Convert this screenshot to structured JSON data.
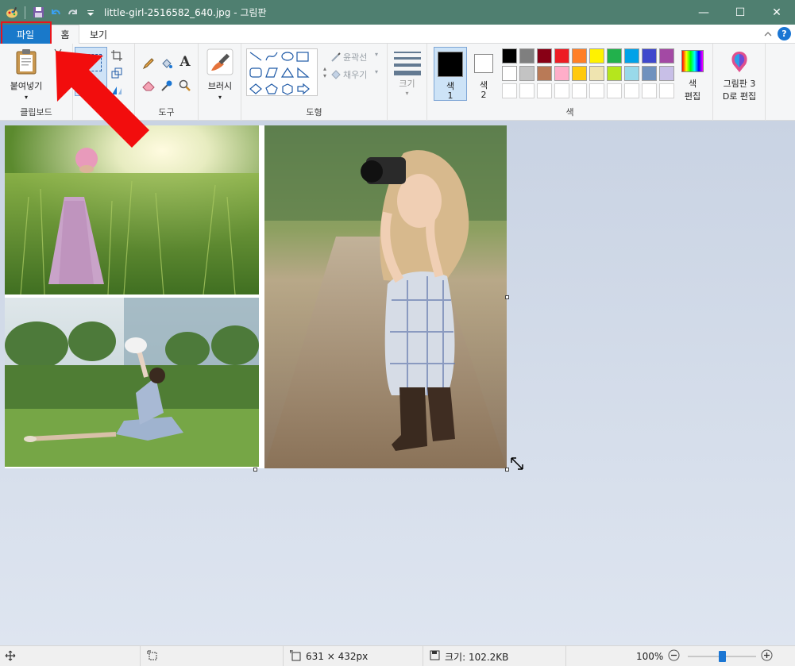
{
  "window": {
    "title": "little-girl-2516582_640.jpg - 그림판",
    "controls": {
      "minimize": "—",
      "maximize": "☐",
      "close": "✕"
    }
  },
  "menu": {
    "file": "파일",
    "home": "홈",
    "view": "보기"
  },
  "ribbon": {
    "clipboard": {
      "paste": "붙여넣기",
      "label": "클립보드"
    },
    "tools": {
      "label": "도구"
    },
    "brushes": {
      "label": "브러시"
    },
    "shapes": {
      "outline": "윤곽선",
      "fill": "채우기",
      "label": "도형"
    },
    "size": {
      "label": "크기"
    },
    "colors": {
      "color1": "색",
      "color1_num": "1",
      "color2": "색",
      "color2_num": "2",
      "edit_label": "색\n편집",
      "edit_line1": "색",
      "edit_line2": "편집",
      "label": "색",
      "row1": [
        "#000000",
        "#7f7f7f",
        "#880015",
        "#ed1c24",
        "#ff7f27",
        "#fff200",
        "#22b14c",
        "#00a2e8",
        "#3f48cc",
        "#a349a4"
      ],
      "row2": [
        "#ffffff",
        "#c3c3c3",
        "#b97a57",
        "#ffaec9",
        "#ffc90e",
        "#efe4b0",
        "#b5e61d",
        "#99d9ea",
        "#7092be",
        "#c8bfe7"
      ]
    },
    "paint3d": {
      "line1": "그림판 3",
      "line2": "D로 편집"
    }
  },
  "status": {
    "dimensions": "631 × 432px",
    "size": "크기: 102.2KB",
    "zoom": "100%",
    "zoom_level": 0.5
  }
}
